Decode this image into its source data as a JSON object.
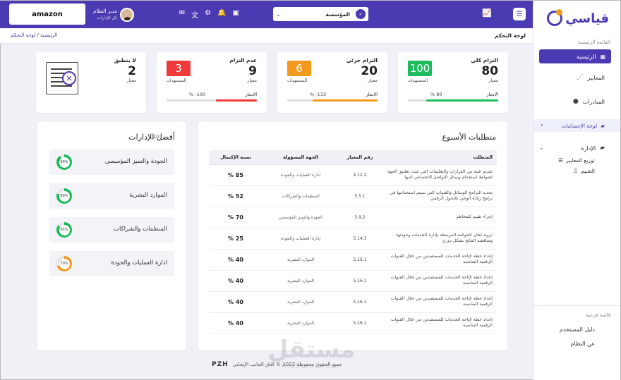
{
  "sidebar": {
    "logo": "قياسي",
    "section_main": "القائمة الرئيسية",
    "home": "الرئيسية",
    "standards": "المعايير",
    "initiatives": "المبادرات",
    "dashboard": "لوحة الإحصائيات",
    "admin": "الإدارة",
    "distribute": "توزيع المعايير",
    "evaluation": "التقييم",
    "section_sub": "قائمة فرعية",
    "user_guide": "دليل المستخدم",
    "about": "عن النظام"
  },
  "header": {
    "org_select": "المؤسسة",
    "user_name": "مدير النظام",
    "user_role": "كل الإدارات",
    "brand": "amazon"
  },
  "breadcrumb": {
    "title": "لوحة التحكم",
    "path": "الرئيسية / لوحة التحكم"
  },
  "stats": [
    {
      "label": "التزام كلي",
      "value": "80",
      "unit": "معيار",
      "badge": "100",
      "badge_label": "المستهدف",
      "achievement_label": "الانجاز",
      "percent": "80 %",
      "progress": 0.8,
      "color": "#1dbb5c"
    },
    {
      "label": "التزام جزئي",
      "value": "20",
      "unit": "معيار",
      "badge": "6",
      "badge_label": "المستهدف",
      "achievement_label": "الانجاز",
      "percent": "133- %",
      "progress": 0.72,
      "color": "#f39a1e"
    },
    {
      "label": "عدم التزام",
      "value": "9",
      "unit": "معيار",
      "badge": "3",
      "badge_label": "المستهدف",
      "achievement_label": "الانجاز",
      "percent": "100- %",
      "progress": 0.45,
      "color": "#ee3a3a"
    },
    {
      "label": "لا ينطبق",
      "value": "2",
      "unit": "معيار"
    }
  ],
  "best": {
    "title": "أفضل الإدارات",
    "all": "الكل",
    "items": [
      {
        "name": "الجودة والتميز المؤسسي",
        "value": "90",
        "progress": 0.9,
        "color": "#1dbb5c"
      },
      {
        "name": "الموارد البشرية",
        "value": "80",
        "progress": 0.8,
        "color": "#1dbb5c"
      },
      {
        "name": "المنظمات والشراكات",
        "value": "85",
        "progress": 0.85,
        "color": "#1dbb5c"
      },
      {
        "name": "ادارة العمليات والجودة",
        "value": "70",
        "progress": 0.7,
        "color": "#f39a1e"
      }
    ]
  },
  "requirements": {
    "title": "متطلبات الأسبوع",
    "columns": [
      "المتطلب",
      "رقم المعيار",
      "الجهة المسؤولة",
      "نسبة الإكتمال"
    ],
    "rows": [
      {
        "req": "تقديم عينة من القرارات والتعليمات التي تثبت تطبيق الجهة لضوابط استخدام وسائل التواصل الاجتماعي لديها",
        "code": "4.12.2",
        "dept": "ادارة العمليات والجودة",
        "pct": "85 %"
      },
      {
        "req": "تحديد البرامج الوسائل والقنوات التي سيتم استخدامها في برامج زيادة الوعي بالتحول الرقمي",
        "code": "5.5.1",
        "dept": "المنظمات والشراكات",
        "pct": "52 %"
      },
      {
        "req": "إجراء تقييم للمخاطر",
        "code": "5.9.2",
        "dept": "الجودة والتميز المؤسسي",
        "pct": "70 %"
      },
      {
        "req": "تزويد لجان الحوكمة المرتبطة بإدارة الخدمات وجودتها، ومناقشة النتائج بشكل دوري",
        "code": "5.14.3",
        "dept": "إدارة العمليات والجودة",
        "pct": "25 %"
      },
      {
        "req": "إعداد خطة لإتاحة الخدمات للمستفيدين من خلال القنوات الرقمية المناسبة",
        "code": "5.16.1",
        "dept": "الموارد البشرية",
        "pct": "40 %"
      },
      {
        "req": "إعداد خطة لإتاحة الخدمات للمستفيدين من خلال القنوات الرقمية المناسبة",
        "code": "5.16.1",
        "dept": "الموارد البشرية",
        "pct": "40 %"
      },
      {
        "req": "إعداد خطة لإتاحة الخدمات للمستفيدين من خلال القنوات الرقمية المناسبة",
        "code": "5.16.1",
        "dept": "الموارد البشرية",
        "pct": "40 %"
      },
      {
        "req": "إعداد خطة لإتاحة الخدمات للمستفيدين من خلال القنوات الرقمية المناسبة",
        "code": "5.16.1",
        "dept": "الموارد البشرية",
        "pct": "40 %"
      }
    ]
  },
  "footer": {
    "copyright": "جميع الحقوق محفوظة 2022 © آفاق الجانب الإيجابي",
    "brand": "PZH",
    "watermark": "مستقل",
    "watermark_url": "mostaql.com"
  },
  "colors": {
    "primary": "#4b3bb3",
    "green": "#1dbb5c",
    "orange": "#f39a1e",
    "red": "#ee3a3a"
  },
  "icons": [
    "menu-icon",
    "chart-icon",
    "search-icon",
    "chevron-down-icon",
    "clipboard-icon",
    "bell-icon",
    "gear-icon",
    "translate-icon",
    "mail-icon",
    "power-icon",
    "home-icon",
    "sitemap-icon",
    "lightbulb-icon",
    "dashboard-icon",
    "building-icon",
    "award-icon"
  ]
}
